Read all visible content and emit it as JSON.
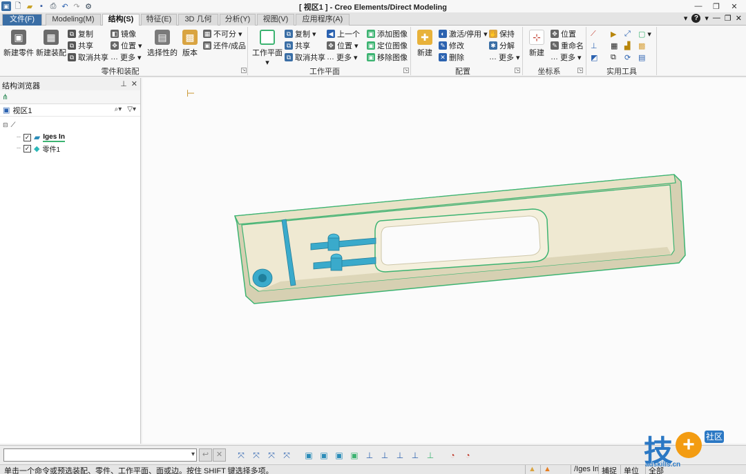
{
  "app": {
    "title": "[ 视区1 ] - Creo Elements/Direct Modeling"
  },
  "qat": {
    "icons": [
      "app-icon",
      "new-icon",
      "open-icon",
      "save-icon",
      "print-preview-icon",
      "undo-icon",
      "redo-icon",
      "customize-icon"
    ]
  },
  "menu": {
    "tabs": [
      "文件(F)",
      "Modeling(M)",
      "结构(S)",
      "特征(E)",
      "3D 几何",
      "分析(Y)",
      "视图(V)",
      "应用程序(A)"
    ],
    "active_tab": "结构(S)"
  },
  "ribbon": {
    "parts_group": {
      "name": "零件和装配",
      "new_part": "新建零件",
      "new_assembly": "新建装配",
      "copy": "复制",
      "share": "共享",
      "unshare": "取消共享",
      "mirror": "镜像",
      "position": "位置",
      "more": "更多",
      "selective": "选择性的",
      "version": "版本",
      "indivisible": "不可分",
      "restore_finished": "还件/成品"
    },
    "workplane_group": {
      "name": "工作平面",
      "workplane": "工作平面",
      "copy": "复制",
      "share": "共享",
      "unshare": "取消共享",
      "prev": "上一个",
      "position": "位置",
      "more": "更多",
      "add_image": "添加图像",
      "locate_image": "定位图像",
      "remove_image": "移除图像"
    },
    "config_group": {
      "name": "配置",
      "new": "新建",
      "activate": "激活/停用",
      "modify": "修改",
      "delete": "删除",
      "keep": "保持",
      "explode": "分解",
      "more": "更多"
    },
    "coord_group": {
      "name": "坐标系",
      "new": "新建",
      "position": "位置",
      "rename": "重命名",
      "more": "更多"
    },
    "tools_group": {
      "name": "实用工具"
    }
  },
  "browser": {
    "title": "结构浏览器",
    "viewport_label": "视区1",
    "items": [
      {
        "label": "Iges In",
        "checked": true
      },
      {
        "label": "零件1",
        "checked": true
      }
    ]
  },
  "cmdbar": {
    "input_value": "",
    "ok_symbol": "↩",
    "cancel_symbol": "✕"
  },
  "status": {
    "message": "单击一个命令或预选装配、零件、工作平面、面或边。按住 SHIFT 键选择多项。",
    "context": "/Iges In",
    "snap": "捕捉",
    "unit": "单位",
    "all": "全部"
  },
  "watermark": {
    "text": "技",
    "badge": "社区",
    "site": "adskills.cn"
  },
  "colors": {
    "model_body": "#e2dcc0",
    "model_edge": "#3cb371",
    "feature_blue": "#3aaacb",
    "accent": "#1e5fb4"
  }
}
